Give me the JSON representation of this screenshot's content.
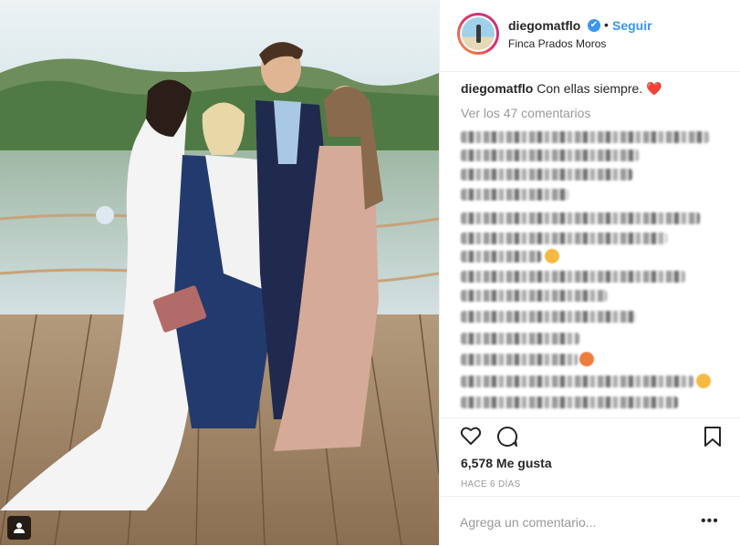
{
  "post": {
    "username": "diegomatflo",
    "verified_mark": "✔",
    "separator": "•",
    "follow_label": "Seguir",
    "location": "Finca Prados Moros",
    "caption_user": "diegomatflo",
    "caption_text": "Con ellas siempre.",
    "caption_emoji": "❤️",
    "view_all_comments": "Ver los 47 comentarios",
    "likes": "6,578 Me gusta",
    "timestamp": "HACE 6 DÍAS",
    "add_comment_placeholder": "Agrega un comentario...",
    "more_options": "•••"
  },
  "icons": {
    "verified": "verified-badge-icon",
    "like": "heart-outline-icon",
    "comment": "comment-bubble-icon",
    "save": "bookmark-icon",
    "tag": "user-tag-icon",
    "more": "more-options-icon"
  },
  "colors": {
    "accent": "#3897f0",
    "text": "#262626",
    "muted": "#999999",
    "border": "#efefef"
  }
}
